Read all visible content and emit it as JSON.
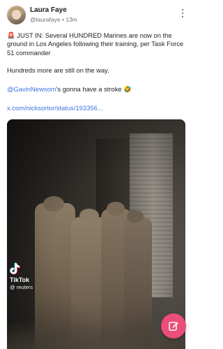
{
  "post": {
    "author": {
      "display_name": "Laura Faye",
      "handle": "@laurafaye",
      "separator": "•",
      "time": "13m"
    },
    "text": {
      "para1_emoji": "🚨",
      "para1": "JUST IN: Several HUNDRED Marines are now on the ground in Los Angeles following their training, per Task Force 51 commander",
      "para2": "Hundreds more are still on the way.",
      "para3_mention": "@GavinNewsom",
      "para3_rest": "’s gonna have a stroke 🤣",
      "link": "x.com/nicksortor/status/193356..."
    },
    "media": {
      "watermark_app": "TikTok",
      "watermark_handle": "@ reuters"
    }
  },
  "colors": {
    "link": "#3a73e0",
    "fab": "#ea4e79",
    "text": "#1f1f24",
    "muted": "#6f7076"
  },
  "icons": {
    "more": "vertical-dots-icon",
    "compose": "compose-pencil-icon",
    "tiktok": "tiktok-icon"
  }
}
